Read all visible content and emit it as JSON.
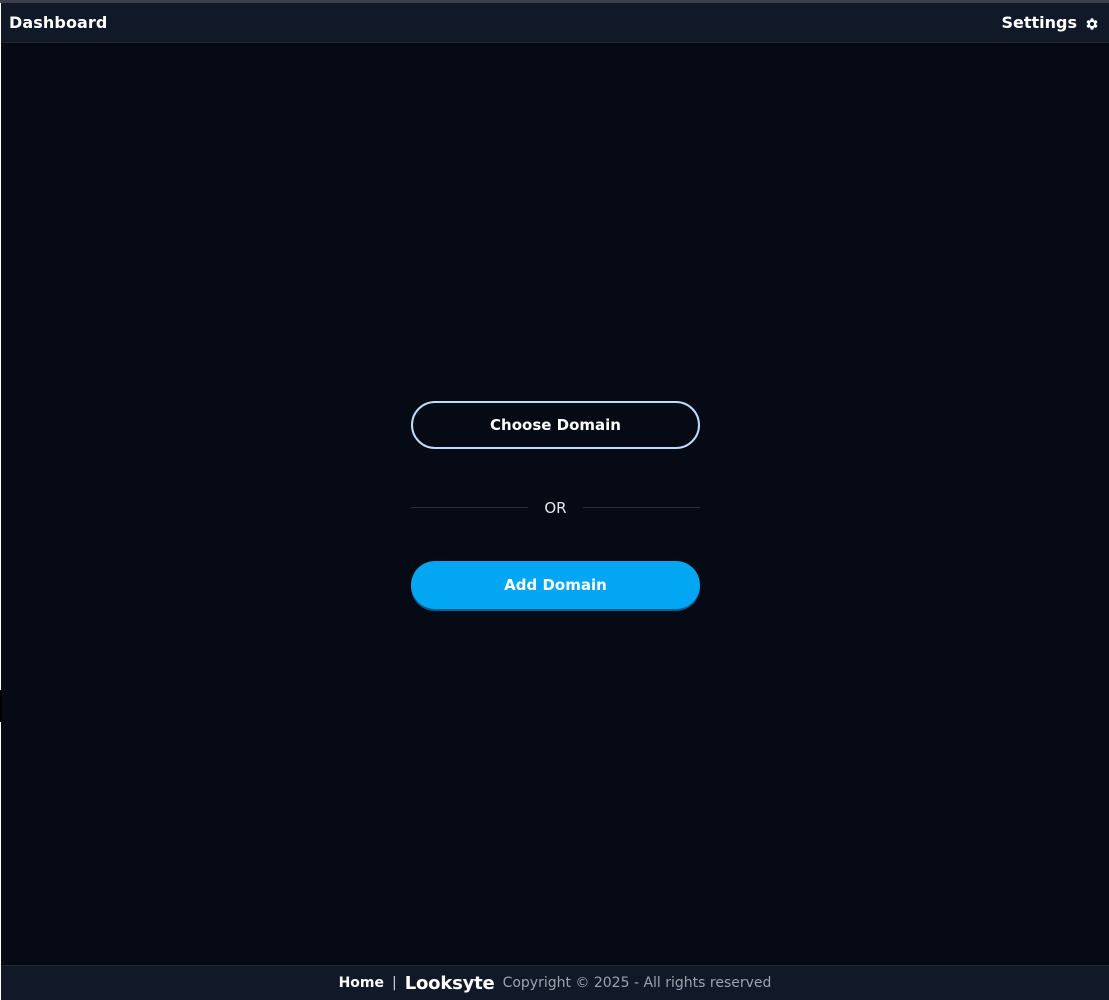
{
  "header": {
    "title": "Dashboard",
    "settings_label": "Settings",
    "settings_icon": "gear-icon"
  },
  "main": {
    "choose_domain_label": "Choose Domain",
    "divider_text": "OR",
    "add_domain_label": "Add Domain"
  },
  "footer": {
    "home_label": "Home",
    "separator": "|",
    "brand": "Looksyte",
    "copyright": "Copyright © 2025 - All rights reserved"
  },
  "colors": {
    "background": "#050a15",
    "header_bg": "#111827",
    "primary_button": "#03a6f2",
    "outline_border": "#bfdbfe"
  }
}
